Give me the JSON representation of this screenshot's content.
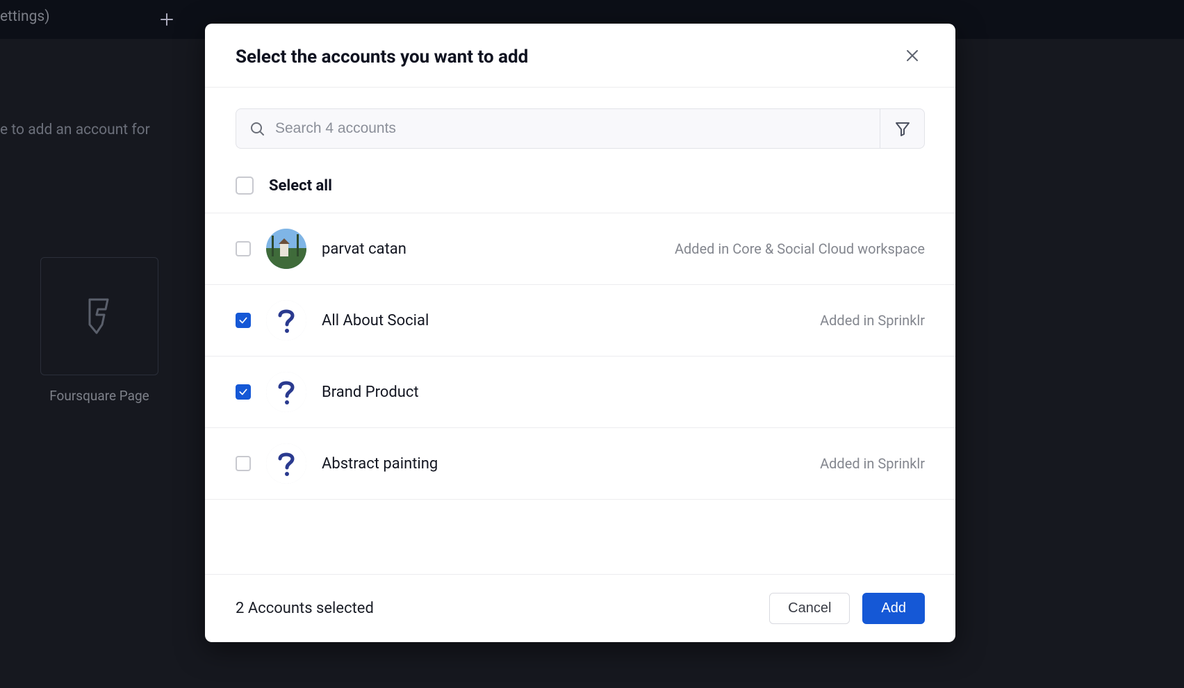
{
  "background": {
    "settings_text": "ettings)",
    "subtitle": "e to add an account for",
    "card_label": "Foursquare Page"
  },
  "modal": {
    "title": "Select the accounts you want to add",
    "search": {
      "placeholder": "Search 4 accounts"
    },
    "select_all_label": "Select all",
    "accounts": [
      {
        "name": "parvat catan",
        "status": "Added in Core & Social Cloud workspace",
        "checked": false,
        "avatar": "photo"
      },
      {
        "name": "All About Social",
        "status": "Added in Sprinklr",
        "checked": true,
        "avatar": "question"
      },
      {
        "name": "Brand Product",
        "status": "",
        "checked": true,
        "avatar": "question"
      },
      {
        "name": "Abstract painting",
        "status": "Added in Sprinklr",
        "checked": false,
        "avatar": "question"
      }
    ],
    "footer": {
      "selected_text": "2 Accounts selected",
      "cancel_label": "Cancel",
      "add_label": "Add"
    }
  }
}
